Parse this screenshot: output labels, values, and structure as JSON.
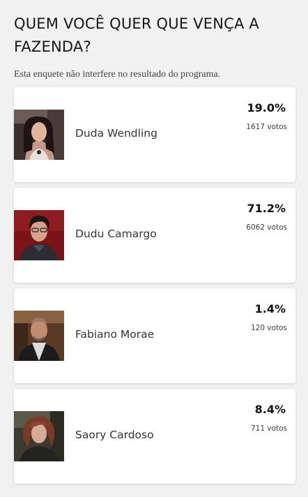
{
  "poll": {
    "title": "QUEM VOCÊ QUER QUE VENÇA A FAZENDA?",
    "disclaimer": "Esta enquete não interfere no resultado do programa."
  },
  "candidates": [
    {
      "name": "Duda Wendling",
      "percent": "19.0%",
      "votes": "1617 votos",
      "photo_icon": "contestant-photo"
    },
    {
      "name": "Dudu Camargo",
      "percent": "71.2%",
      "votes": "6062 votos",
      "photo_icon": "contestant-photo"
    },
    {
      "name": "Fabiano Morae",
      "percent": "1.4%",
      "votes": "120 votos",
      "photo_icon": "contestant-photo"
    },
    {
      "name": "Saory Cardoso",
      "percent": "8.4%",
      "votes": "711 votos",
      "photo_icon": "contestant-photo"
    }
  ],
  "colors": {
    "background": "#f1f1f1",
    "card": "#ffffff",
    "text": "#1b1b1b"
  }
}
